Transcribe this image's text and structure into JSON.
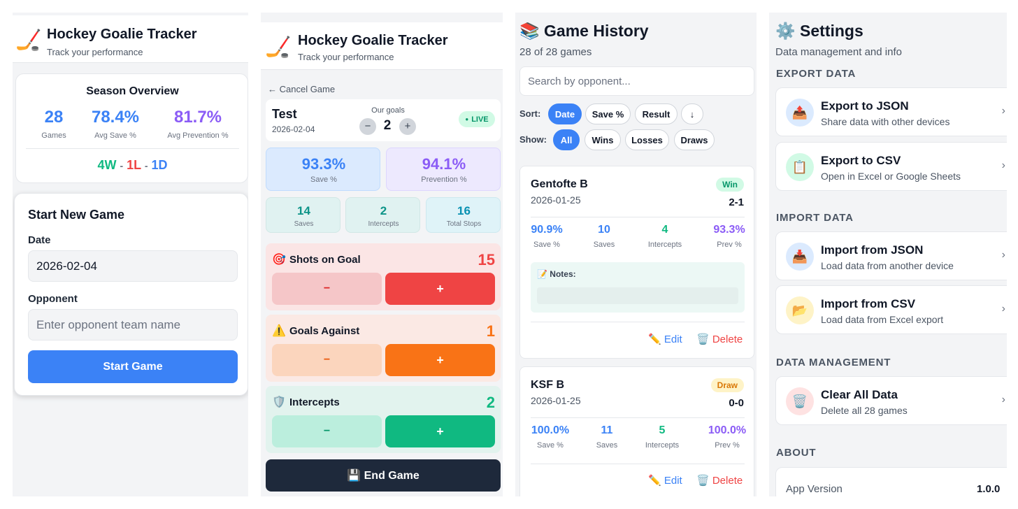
{
  "screen1": {
    "header": {
      "title": "Hockey Goalie Tracker",
      "subtitle": "Track your performance",
      "icon": "🏒"
    },
    "season": {
      "title": "Season Overview",
      "games_value": "28",
      "games_label": "Games",
      "avg_save_value": "78.4%",
      "avg_save_label": "Avg Save %",
      "avg_prev_value": "81.7%",
      "avg_prev_label": "Avg Prevention %",
      "record_w": "4W",
      "record_l": "1L",
      "record_d": "1D",
      "sep": "-"
    },
    "start": {
      "title": "Start New Game",
      "date_label": "Date",
      "date_value": "2026-02-04",
      "opponent_label": "Opponent",
      "opponent_placeholder": "Enter opponent team name",
      "button": "Start Game"
    }
  },
  "screen2": {
    "header": {
      "title": "Hockey Goalie Tracker",
      "subtitle": "Track your performance",
      "icon": "🏒"
    },
    "cancel": "← Cancel Game",
    "game": {
      "opponent": "Test",
      "date": "2026-02-04",
      "goals_label": "Our goals",
      "goals_value": "2",
      "minus": "−",
      "plus": "+",
      "live": "LIVE"
    },
    "save_pct": {
      "value": "93.3%",
      "label": "Save %"
    },
    "prev_pct": {
      "value": "94.1%",
      "label": "Prevention %"
    },
    "saves": {
      "value": "14",
      "label": "Saves"
    },
    "intercepts_stat": {
      "value": "2",
      "label": "Intercepts"
    },
    "total_stops": {
      "value": "16",
      "label": "Total Stops"
    },
    "counters": [
      {
        "icon": "🎯",
        "label": "Shots on Goal",
        "value": "15",
        "minus": "−",
        "plus": "+"
      },
      {
        "icon": "⚠️",
        "label": "Goals Against",
        "value": "1",
        "minus": "−",
        "plus": "+"
      },
      {
        "icon": "🛡️",
        "label": "Intercepts",
        "value": "2",
        "minus": "−",
        "plus": "+"
      }
    ],
    "end_button": "💾 End Game"
  },
  "screen3": {
    "title": "📚 Game History",
    "count": "28 of 28 games",
    "search_placeholder": "Search by opponent...",
    "sort_label": "Sort:",
    "sort_options": [
      "Date",
      "Save %",
      "Result",
      "↓"
    ],
    "show_label": "Show:",
    "show_options": [
      "All",
      "Wins",
      "Losses",
      "Draws"
    ],
    "games": [
      {
        "opponent": "Gentofte B",
        "date": "2026-01-25",
        "result": "Win",
        "score": "2-1",
        "save_value": "90.9%",
        "save_label": "Save %",
        "saves_value": "10",
        "saves_label": "Saves",
        "int_value": "4",
        "int_label": "Intercepts",
        "prev_value": "93.3%",
        "prev_label": "Prev %",
        "notes_label": "📝 Notes:",
        "edit": "✏️ Edit",
        "delete": "🗑️ Delete"
      },
      {
        "opponent": "KSF B",
        "date": "2026-01-25",
        "result": "Draw",
        "score": "0-0",
        "save_value": "100.0%",
        "save_label": "Save %",
        "saves_value": "11",
        "saves_label": "Saves",
        "int_value": "5",
        "int_label": "Intercepts",
        "prev_value": "100.0%",
        "prev_label": "Prev %",
        "edit": "✏️ Edit",
        "delete": "🗑️ Delete"
      }
    ]
  },
  "screen4": {
    "title": "⚙️ Settings",
    "subtitle": "Data management and info",
    "export_header": "EXPORT DATA",
    "export_json": {
      "icon": "📤",
      "title": "Export to JSON",
      "sub": "Share data with other devices"
    },
    "export_csv": {
      "icon": "📋",
      "title": "Export to CSV",
      "sub": "Open in Excel or Google Sheets"
    },
    "import_header": "IMPORT DATA",
    "import_json": {
      "icon": "📥",
      "title": "Import from JSON",
      "sub": "Load data from another device"
    },
    "import_csv": {
      "icon": "📂",
      "title": "Import from CSV",
      "sub": "Load data from Excel export"
    },
    "manage_header": "DATA MANAGEMENT",
    "clear": {
      "icon": "🗑️",
      "title": "Clear All Data",
      "sub": "Delete all 28 games"
    },
    "about_header": "ABOUT",
    "app_version_label": "App Version",
    "app_version_value": "1.0.0",
    "chevron": "›"
  },
  "colors": {
    "primary": "#3b82f6",
    "purple": "#8b5cf6",
    "green": "#10b981",
    "red": "#ef4444",
    "orange": "#f97316",
    "dark": "#1f2937"
  }
}
